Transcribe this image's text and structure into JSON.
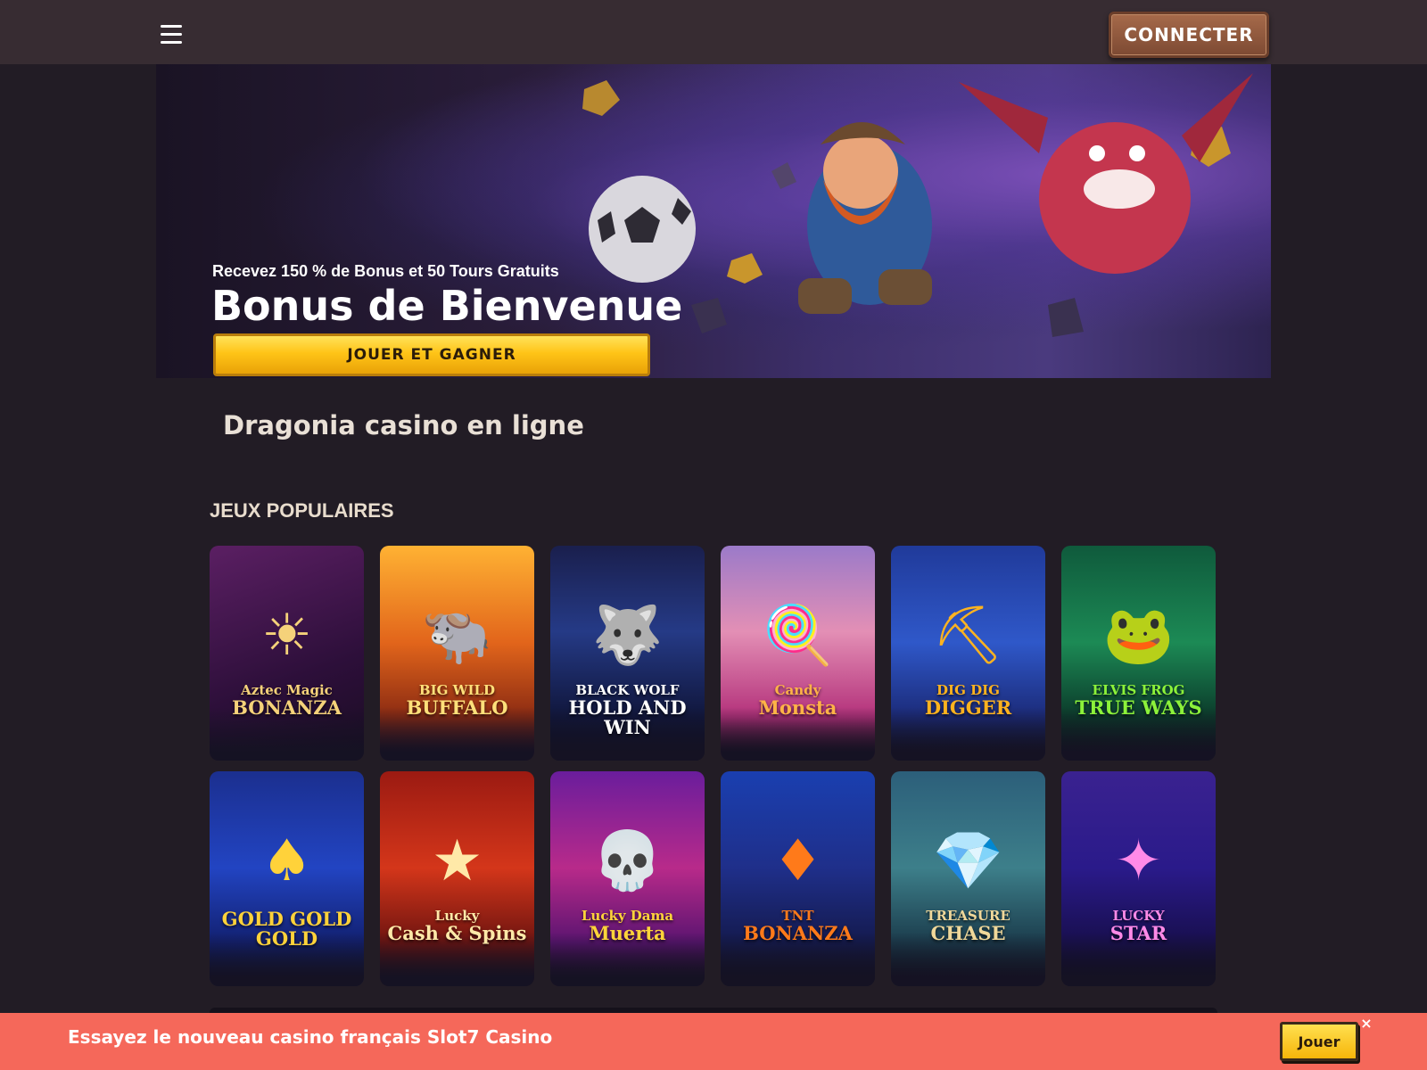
{
  "header": {
    "login_label": "CONNECTER"
  },
  "banner": {
    "subtitle": "Recevez 150 % de Bonus et 50 Tours Gratuits",
    "title": "Bonus de Bienvenue",
    "cta_label": "JOUER ET GAGNER"
  },
  "page": {
    "heading": "Dragonia casino en ligne"
  },
  "games": {
    "section_title": "JEUX POPULAIRES",
    "items": [
      {
        "l1": "Aztec Magic",
        "l2": "BONANZA",
        "icon": "aztec-chief-icon",
        "glyph": "☀",
        "bg": "linear-gradient(160deg,#5b1f63,#2d0f3a 60%,#1a0c22)",
        "color": "#f5d27a"
      },
      {
        "l1": "BIG WILD",
        "l2": "BUFFALO",
        "icon": "buffalo-icon",
        "glyph": "🐃",
        "bg": "linear-gradient(180deg,#ffb233,#e2651b 45%,#8a2a12 80%,#2a1224)",
        "color": "#ffe07a"
      },
      {
        "l1": "BLACK WOLF",
        "l2": "HOLD AND WIN",
        "icon": "wolf-icon",
        "glyph": "🐺",
        "bg": "linear-gradient(180deg,#1a1f4d,#253a86 40%,#10163b 80%,#0c0f22)",
        "color": "#ffffff"
      },
      {
        "l1": "Candy",
        "l2": "Monsta",
        "icon": "candy-monster-icon",
        "glyph": "🍭",
        "bg": "linear-gradient(180deg,#9b7ac9,#e38fb5 40%,#b3307a 80%,#2a1224)",
        "color": "#ffb347"
      },
      {
        "l1": "DIG DIG",
        "l2": "DIGGER",
        "icon": "digger-icon",
        "glyph": "⛏",
        "bg": "linear-gradient(180deg,#203a9a,#2f58c9 45%,#1b2a78 80%,#0f1630)",
        "color": "#ffb31f"
      },
      {
        "l1": "ELVIS FROG",
        "l2": "TRUE WAYS",
        "icon": "frog-icon",
        "glyph": "🐸",
        "bg": "linear-gradient(180deg,#0f5a3c,#1c8a55 45%,#0b3a2a 80%,#0b1a1a)",
        "color": "#8cf23a"
      },
      {
        "l1": "",
        "l2": "GOLD GOLD GOLD",
        "icon": "casino-chips-icon",
        "glyph": "♠",
        "bg": "linear-gradient(180deg,#1b2f8f,#2244c2 45%,#122070 80%,#0c1230)",
        "color": "#ffd23a"
      },
      {
        "l1": "Lucky",
        "l2": "Cash & Spins",
        "icon": "star-icon",
        "glyph": "★",
        "bg": "linear-gradient(180deg,#9b1a12,#d4361a 45%,#6e1410 80%,#1e0f18)",
        "color": "#ffe9a8"
      },
      {
        "l1": "Lucky Dama",
        "l2": "Muerta",
        "icon": "catrina-icon",
        "glyph": "💀",
        "bg": "linear-gradient(180deg,#6a1d9c,#b82a8a 45%,#5a1470 80%,#1c0c24)",
        "color": "#ffd43a"
      },
      {
        "l1": "TNT",
        "l2": "BONANZA",
        "icon": "ruby-gem-icon",
        "glyph": "♦",
        "bg": "linear-gradient(180deg,#1a3fb0,#1f2f8a 45%,#141a4e 80%,#0f0f1f)",
        "color": "#ff7a1a"
      },
      {
        "l1": "TREASURE",
        "l2": "CHASE",
        "icon": "adventurer-icon",
        "glyph": "💎",
        "bg": "linear-gradient(180deg,#2c5f7a,#3d7f8a 45%,#1b3c4c 80%,#0f1a24)",
        "color": "#f0d89a"
      },
      {
        "l1": "LUCKY",
        "l2": "STAR",
        "icon": "rainbow-star-icon",
        "glyph": "✦",
        "bg": "linear-gradient(180deg,#3a2290,#2a1a8a 45%,#180f4e 80%,#0c0a20)",
        "color": "#ff8ae8"
      }
    ]
  },
  "promo": {
    "text": "Essayez le nouveau casino français Slot7 Casino",
    "cta_label": "Jouer",
    "close_glyph": "×"
  },
  "colors": {
    "background": "#221c25",
    "topbar": "#372c32",
    "cta_yellow": "#ffc417",
    "login_brown": "#8c5639",
    "promo_bar": "#f5685a"
  }
}
